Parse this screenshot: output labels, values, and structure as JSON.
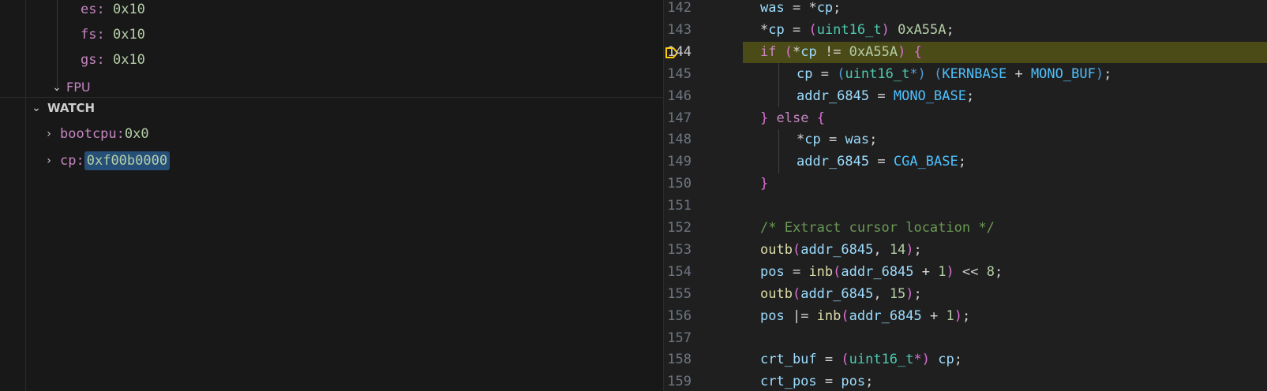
{
  "registers": [
    {
      "name": "es",
      "sep": ": ",
      "value": "0x10"
    },
    {
      "name": "fs",
      "sep": ": ",
      "value": "0x10"
    },
    {
      "name": "gs",
      "sep": ": ",
      "value": "0x10"
    }
  ],
  "fpu": {
    "label": "FPU"
  },
  "watch": {
    "title": "WATCH",
    "items": [
      {
        "name": "bootcpu",
        "sep": ": ",
        "value": "0x0"
      },
      {
        "name": "cp",
        "sep": ": ",
        "value": "0xf00b0000"
      }
    ]
  },
  "editor": {
    "current_line": "144",
    "lines": [
      {
        "no": "142"
      },
      {
        "no": "143"
      },
      {
        "no": "144"
      },
      {
        "no": "145"
      },
      {
        "no": "146"
      },
      {
        "no": "147"
      },
      {
        "no": "148"
      },
      {
        "no": "149"
      },
      {
        "no": "150"
      },
      {
        "no": "151"
      },
      {
        "no": "152"
      },
      {
        "no": "153"
      },
      {
        "no": "154"
      },
      {
        "no": "155"
      },
      {
        "no": "156"
      },
      {
        "no": "157"
      },
      {
        "no": "158"
      },
      {
        "no": "159"
      }
    ],
    "code": {
      "l142": [
        "was",
        " = ",
        "*",
        "cp",
        ";"
      ],
      "l143": [
        "*",
        "cp",
        " = ",
        "(",
        "uint16_t",
        ")",
        " ",
        "0xA55A",
        ";"
      ],
      "l144": [
        "if",
        " ",
        "(",
        "*",
        "cp",
        " != ",
        "0xA55A",
        ")",
        " ",
        "{"
      ],
      "l145": [
        "cp",
        " = ",
        "(",
        "uint16_t",
        "*)",
        " ",
        "(",
        "KERNBASE",
        " + ",
        "MONO_BUF",
        ")",
        ";"
      ],
      "l146": [
        "addr_6845",
        " = ",
        "MONO_BASE",
        ";"
      ],
      "l147": [
        "}",
        " ",
        "else",
        " ",
        "{"
      ],
      "l148": [
        "*",
        "cp",
        " = ",
        "was",
        ";"
      ],
      "l149": [
        "addr_6845",
        " = ",
        "CGA_BASE",
        ";"
      ],
      "l150": [
        "}"
      ],
      "l152": [
        "/* Extract cursor location */"
      ],
      "l153": [
        "outb",
        "(",
        "addr_6845",
        ", ",
        "14",
        ")",
        ";"
      ],
      "l154": [
        "pos",
        " = ",
        "inb",
        "(",
        "addr_6845",
        " + ",
        "1",
        ")",
        " << ",
        "8",
        ";"
      ],
      "l155": [
        "outb",
        "(",
        "addr_6845",
        ", ",
        "15",
        ")",
        ";"
      ],
      "l156": [
        "pos",
        " |= ",
        "inb",
        "(",
        "addr_6845",
        " + ",
        "1",
        ")",
        ";"
      ],
      "l158": [
        "crt_buf",
        " = ",
        "(",
        "uint16_t",
        "*)",
        " ",
        "cp",
        ";"
      ],
      "l159": [
        "crt_pos",
        " = ",
        "pos",
        ";"
      ]
    }
  },
  "colors": {
    "breakpoint": "#ffcc00",
    "current_line_bg": "#4b4b18",
    "watch_highlight": "#264f78"
  },
  "icons": [
    "chevron-down-icon",
    "chevron-right-icon",
    "breakpoint-current-icon"
  ]
}
